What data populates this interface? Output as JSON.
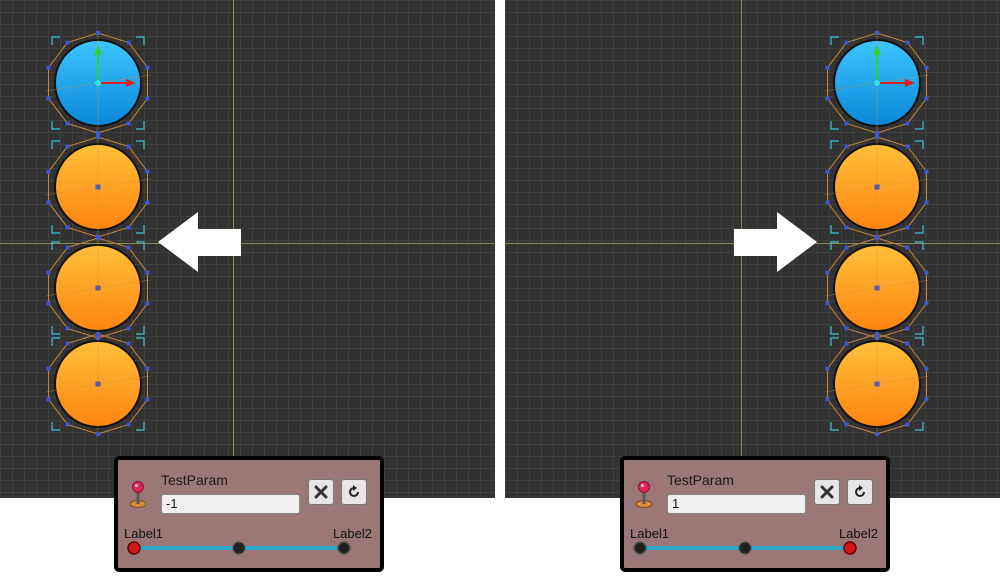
{
  "panels": [
    {
      "param_name": "TestParam",
      "value": "-1",
      "slider": {
        "label_min": "Label1",
        "label_max": "Label2",
        "position": 0.0
      }
    },
    {
      "param_name": "TestParam",
      "value": "1",
      "slider": {
        "label_min": "Label1",
        "label_max": "Label2",
        "position": 1.0
      }
    }
  ],
  "arrows": [
    "left",
    "right"
  ],
  "colors": {
    "viewport_bg": "#323232",
    "grid_line": "#3f3f3f",
    "axis_line": "#8d8a52",
    "panel_bg": "#9c7777",
    "circle_blue": "#1aa7ec",
    "circle_orange": "#ff9f1a",
    "mesh_outline": "#c9863a",
    "vertex": "#3c56d6",
    "selection_bracket": "#38c6d8",
    "slider_track": "#2aa7c8",
    "handle_active": "#d01818",
    "handle_inactive": "#222222"
  }
}
